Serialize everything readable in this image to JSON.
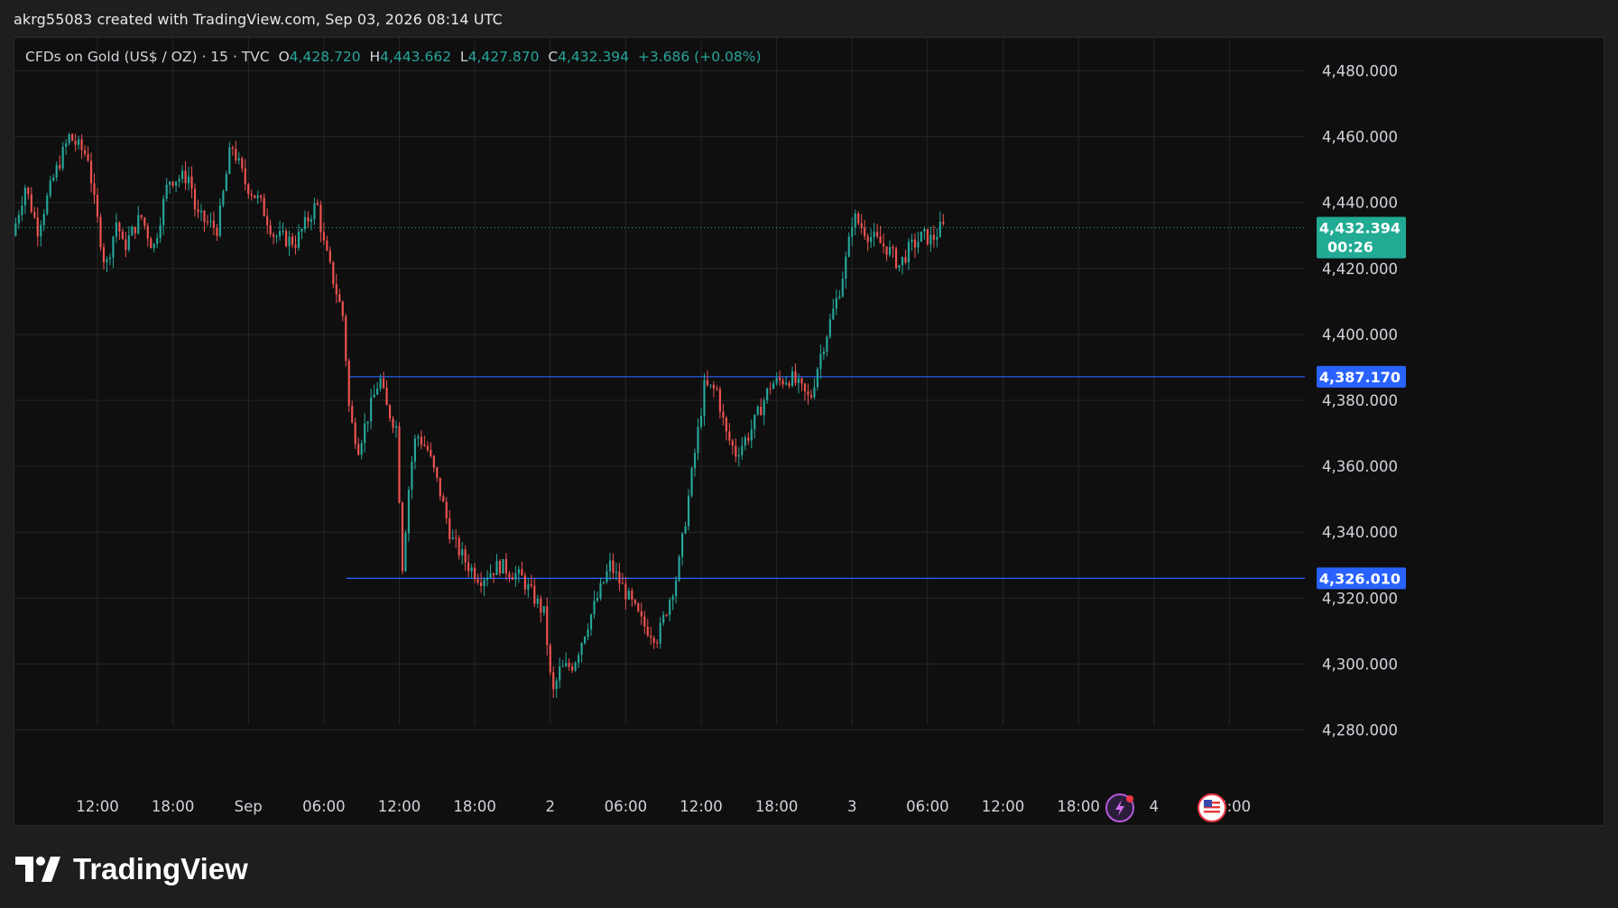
{
  "caption": "akrg55083 created with TradingView.com, Sep 03, 2026 08:14 UTC",
  "legend": {
    "symbol": "CFDs on Gold (US$ / OZ) · 15 · TVC",
    "o_label": "O",
    "o_value": "4,428.720",
    "h_label": "H",
    "h_value": "4,443.662",
    "l_label": "L",
    "l_value": "4,427.870",
    "c_label": "C",
    "c_value": "4,432.394",
    "change": "+3.686 (+0.08%)"
  },
  "brand": "TradingView",
  "icons": {
    "logo": "tradingview-logo-icon",
    "event": "lightning-event-icon",
    "flag": "us-flag-event-icon"
  },
  "colors": {
    "up": "#26a69a",
    "down": "#ef5350",
    "hline": "#2962ff",
    "background": "#0f0f0f",
    "grid": "#262626"
  },
  "chart_data": {
    "type": "candlestick",
    "instrument": "CFDs on Gold (US$ / OZ)",
    "interval": "15",
    "ylim": [
      4264,
      4490
    ],
    "yticks": [
      4280,
      4300,
      4320,
      4340,
      4360,
      4380,
      4400,
      4420,
      4440,
      4460,
      4480
    ],
    "ytick_labels": [
      "4,280.000",
      "4,300.000",
      "4,320.000",
      "4,340.000",
      "4,360.000",
      "4,380.000",
      "4,400.000",
      "4,420.000",
      "4,440.000",
      "4,460.000",
      "4,480.000"
    ],
    "xticks": [
      "12:00",
      "18:00",
      "Sep",
      "06:00",
      "12:00",
      "18:00",
      "2",
      "06:00",
      "12:00",
      "18:00",
      "3",
      "06:00",
      "12:00",
      "18:00",
      "4",
      "06:00"
    ],
    "xtick_hours": [
      12,
      18,
      24,
      30,
      36,
      42,
      48,
      54,
      60,
      66,
      72,
      78,
      84,
      90,
      96,
      102
    ],
    "x_hour_range": [
      5.4,
      108
    ],
    "horizontal_lines": [
      {
        "price": 4387.17,
        "label": "4,387.170",
        "start_hour": 32
      },
      {
        "price": 4326.01,
        "label": "4,326.010",
        "start_hour": 31.8
      }
    ],
    "last_price": {
      "price": 4432.394,
      "label": "4,432.394",
      "countdown": "00:26"
    },
    "path_hours": [
      5.5,
      6.5,
      7.5,
      8.8,
      10.0,
      11.5,
      12.0,
      12.9,
      13.8,
      14.3,
      15.7,
      16.7,
      17.9,
      19.6,
      20.1,
      21.8,
      22.9,
      24.0,
      25.2,
      26.3,
      28.0,
      29.7,
      30.2,
      31.8,
      32.3,
      33.0,
      34.7,
      35.2,
      36.0,
      36.5,
      37.1,
      37.6,
      38.5,
      39.5,
      40.4,
      41.7,
      42.7,
      44.2,
      46.0,
      47.8,
      48.4,
      49.0,
      50.1,
      51.1,
      53.0,
      54.2,
      55.6,
      56.8,
      58.4,
      59.6,
      60.5,
      61.5,
      62.2,
      63.0,
      64.1,
      65.8,
      67.4,
      68.9,
      69.6,
      71.2,
      71.9,
      72.3,
      73.6,
      75.1,
      76.0,
      76.8,
      77.9,
      78.6,
      79.3
    ],
    "path_prices": [
      4430,
      4445,
      4432,
      4448,
      4460,
      4454,
      4440,
      4420,
      4435,
      4426,
      4436,
      4426,
      4447,
      4448,
      4436,
      4432,
      4458,
      4446,
      4440,
      4430,
      4428,
      4440,
      4428,
      4405,
      4375,
      4366,
      4387,
      4378,
      4372,
      4330,
      4358,
      4370,
      4365,
      4352,
      4338,
      4330,
      4326,
      4330,
      4326,
      4315,
      4290,
      4298,
      4300,
      4311,
      4330,
      4322,
      4312,
      4308,
      4328,
      4360,
      4384,
      4383,
      4370,
      4364,
      4370,
      4385,
      4387,
      4380,
      4392,
      4413,
      4425,
      4436,
      4430,
      4426,
      4421,
      4426,
      4430,
      4428.72,
      4432.394
    ]
  }
}
